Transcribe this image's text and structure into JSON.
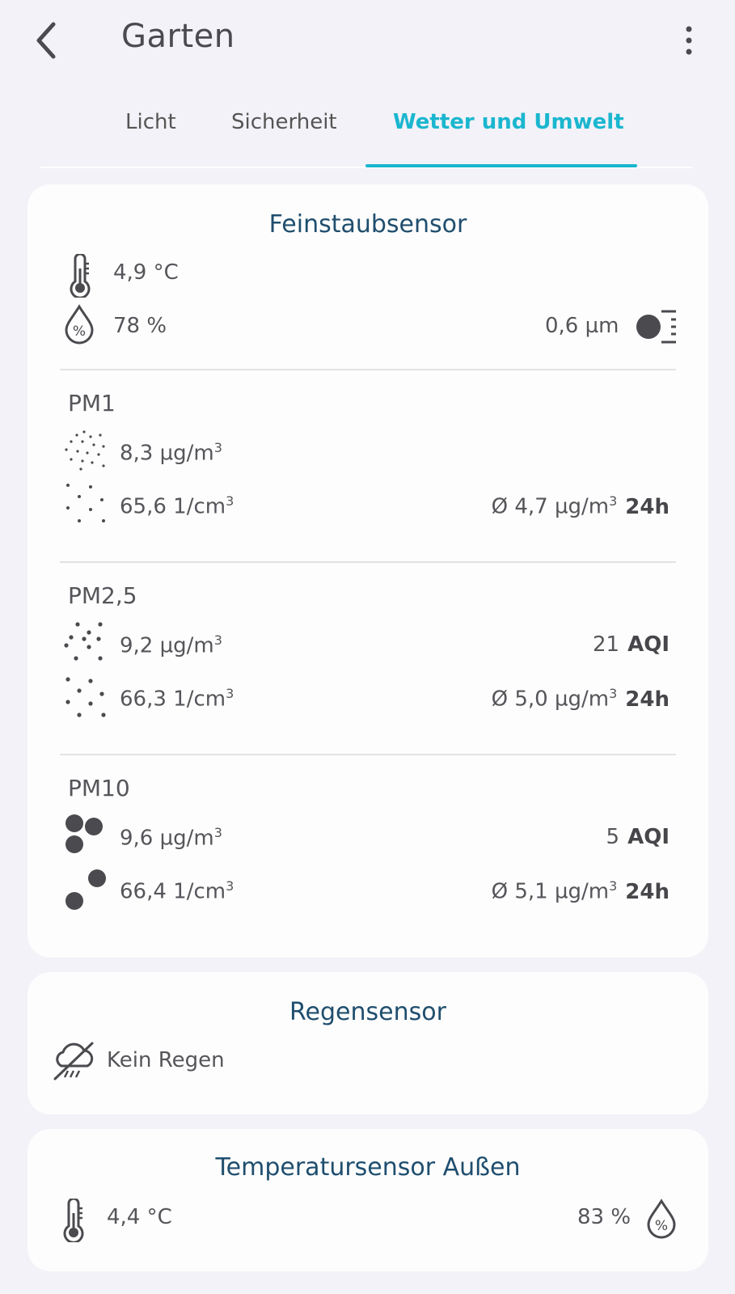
{
  "header": {
    "title": "Garten",
    "back_icon": "chevron-left-icon",
    "menu_icon": "more-vertical-icon"
  },
  "tabs": [
    {
      "label": "Licht"
    },
    {
      "label": "Sicherheit"
    },
    {
      "label": "Wetter und Umwelt",
      "active": true
    }
  ],
  "colors": {
    "accent": "#1ab6cf",
    "card_title": "#1f4e6e",
    "background": "#f2f2f8"
  },
  "feinstaub": {
    "title": "Feinstaubsensor",
    "temperature": "4,9 °C",
    "humidity": "78 %",
    "particle_size": "0,6 µm",
    "pm1": {
      "label": "PM1",
      "mass": "8,3 µg/m",
      "count": "65,6 1/cm",
      "avg": "Ø 4,7 µg/m",
      "avg_unit": "24h"
    },
    "pm25": {
      "label": "PM2,5",
      "mass": "9,2 µg/m",
      "aqi_value": "21",
      "aqi_label": "AQI",
      "count": "66,3 1/cm",
      "avg": "Ø 5,0 µg/m",
      "avg_unit": "24h"
    },
    "pm10": {
      "label": "PM10",
      "mass": "9,6 µg/m",
      "aqi_value": "5",
      "aqi_label": "AQI",
      "count": "66,4 1/cm",
      "avg": "Ø 5,1 µg/m",
      "avg_unit": "24h"
    }
  },
  "regen": {
    "title": "Regensensor",
    "status": "Kein Regen"
  },
  "temperatur": {
    "title": "Temperatursensor Außen",
    "temperature": "4,4 °C",
    "humidity": "83 %"
  }
}
